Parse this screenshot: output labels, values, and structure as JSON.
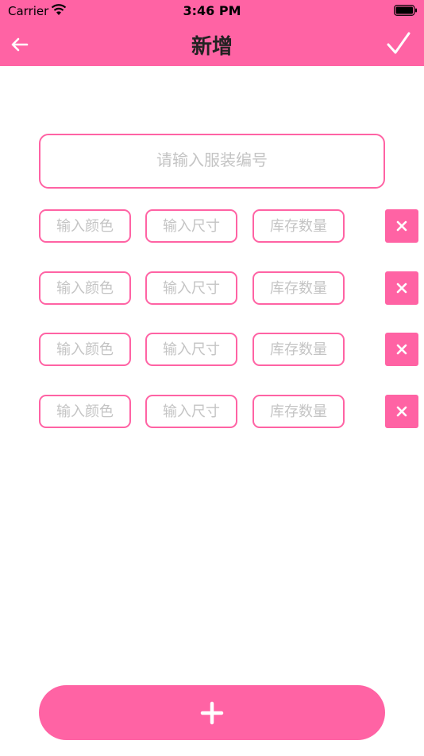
{
  "status_bar": {
    "carrier": "Carrier",
    "time": "3:46 PM"
  },
  "nav": {
    "title": "新增",
    "back_icon": "arrow-left-icon",
    "done_icon": "checkmark-icon"
  },
  "form": {
    "code_placeholder": "请输入服装编号",
    "rows": [
      {
        "color_placeholder": "输入颜色",
        "size_placeholder": "输入尺寸",
        "stock_placeholder": "库存数量"
      },
      {
        "color_placeholder": "输入颜色",
        "size_placeholder": "输入尺寸",
        "stock_placeholder": "库存数量"
      },
      {
        "color_placeholder": "输入颜色",
        "size_placeholder": "输入尺寸",
        "stock_placeholder": "库存数量"
      },
      {
        "color_placeholder": "输入颜色",
        "size_placeholder": "输入尺寸",
        "stock_placeholder": "库存数量"
      }
    ]
  },
  "add_button": {
    "icon": "plus-icon"
  },
  "colors": {
    "accent": "#ff63a4",
    "title": "#222222",
    "placeholder": "#c4c4c4"
  }
}
